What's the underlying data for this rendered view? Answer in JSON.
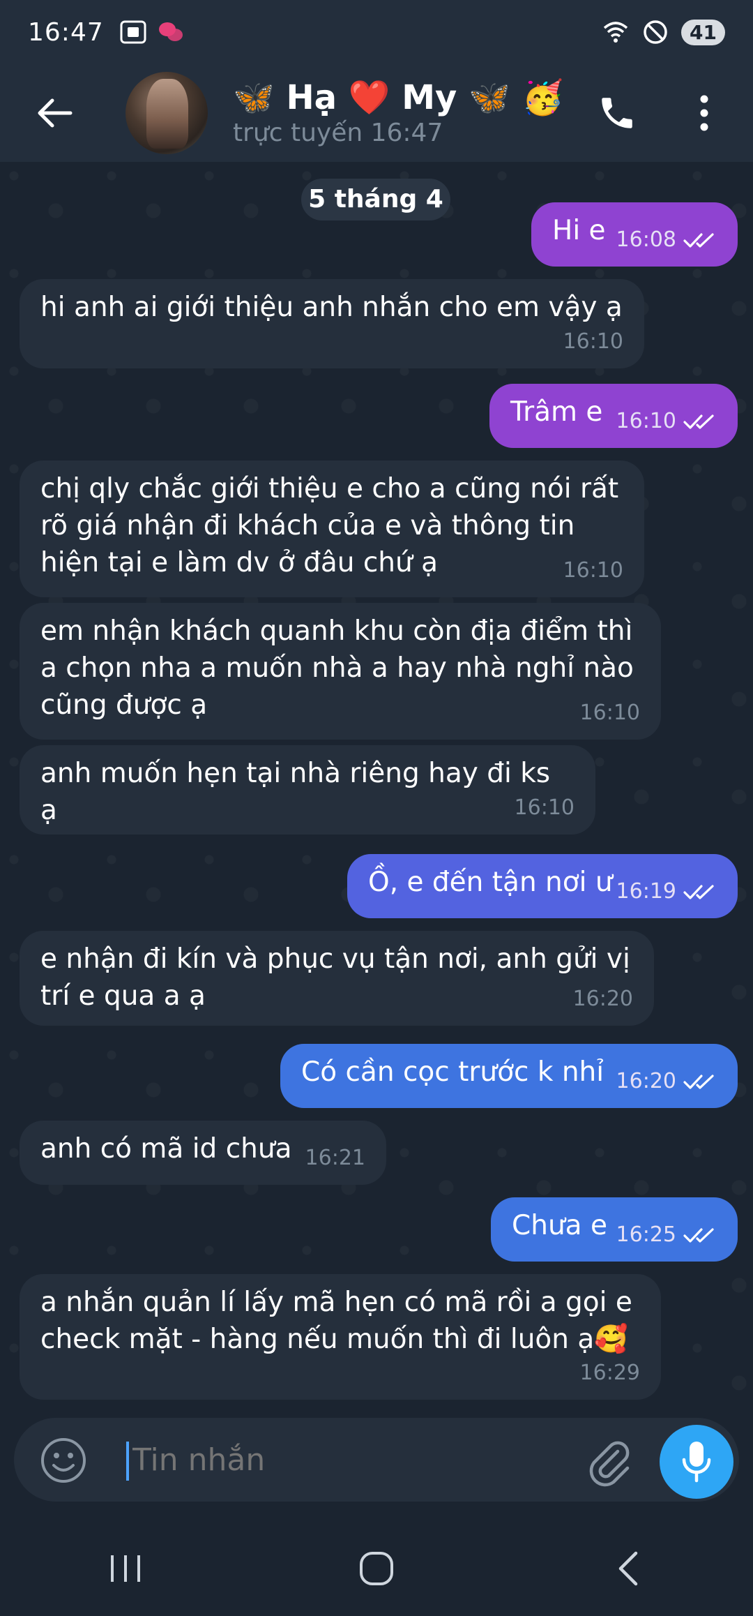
{
  "status_bar": {
    "time": "16:47",
    "battery": "41"
  },
  "header": {
    "title": "🦋 Hạ ❤️ My 🦋 🥳",
    "subtitle": "trực tuyến 16:47"
  },
  "colors": {
    "outgoing_purple": "#8f43d1",
    "outgoing_blue": "#3e74e0",
    "incoming": "#252f3c",
    "accent": "#2ea6f5"
  },
  "chat": {
    "date_chip": "5 tháng 4",
    "messages": [
      {
        "dir": "out",
        "text": "Hi e",
        "time": "16:08"
      },
      {
        "dir": "in",
        "text": "hi anh ai giới thiệu anh nhắn cho em vậy ạ",
        "time": "16:10"
      },
      {
        "dir": "out",
        "text": "Trâm e",
        "time": "16:10"
      },
      {
        "dir": "in",
        "text": "chị qly chắc giới thiệu e cho a cũng nói rất rõ giá nhận đi khách của e và thông tin hiện tại e làm dv ở đâu chứ ạ",
        "time": "16:10"
      },
      {
        "dir": "in",
        "text": "em nhận khách quanh khu còn địa điểm thì a chọn nha a muốn nhà a hay nhà nghỉ nào cũng được ạ",
        "time": "16:10"
      },
      {
        "dir": "in",
        "text": "anh muốn hẹn tại nhà riêng hay đi ks ạ",
        "time": "16:10"
      },
      {
        "dir": "out",
        "text": "Ồ, e đến tận nơi ư",
        "time": "16:19"
      },
      {
        "dir": "in",
        "text": "e nhận đi kín và phục vụ tận nơi, anh gửi vị trí e qua a ạ",
        "time": "16:20"
      },
      {
        "dir": "out",
        "text": "Có cần cọc trước k nhỉ",
        "time": "16:20"
      },
      {
        "dir": "in",
        "text": "anh có mã id chưa",
        "time": "16:21"
      },
      {
        "dir": "out",
        "text": "Chưa e",
        "time": "16:25"
      },
      {
        "dir": "in",
        "text": "a nhắn quản lí lấy mã hẹn có mã rồi a  gọi e check mặt - hàng nếu muốn thì đi luôn ạ🥰",
        "time": "16:29"
      }
    ]
  },
  "composer": {
    "placeholder": "Tin nhắn"
  }
}
